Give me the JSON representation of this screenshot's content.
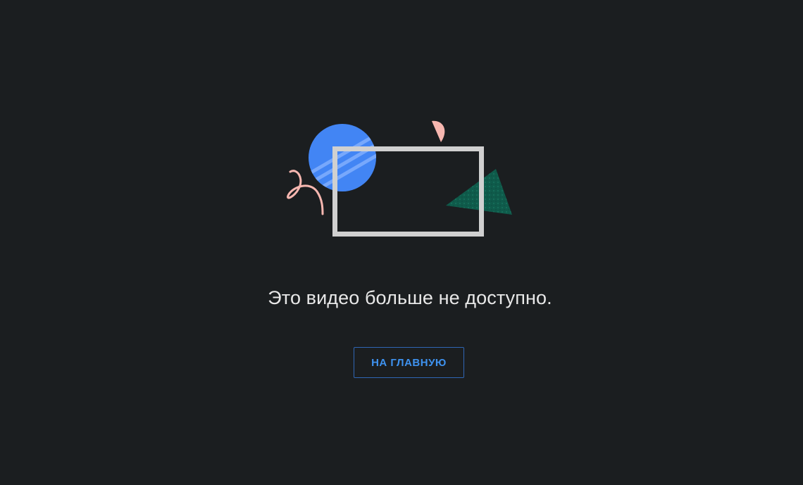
{
  "error_page": {
    "message": "Это видео больше не доступно.",
    "home_button_label": "НА ГЛАВНУЮ"
  },
  "colors": {
    "background": "#1b1e20",
    "message_text": "#e8e8e8",
    "button_text": "#3e92ef",
    "button_border": "#2f66b5",
    "circle": "#4285f4",
    "frame": "#d0d0d0",
    "pink": "#f7b7b0",
    "triangle": "#0f5b4b"
  },
  "icons": {
    "illustration": "broken-video-illustration"
  }
}
